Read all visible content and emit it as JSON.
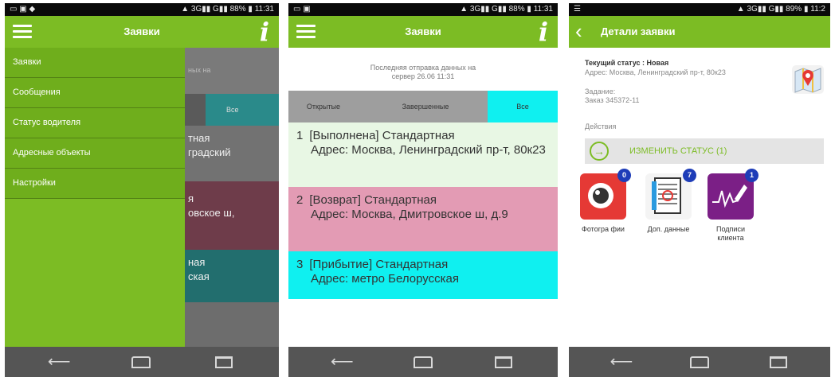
{
  "colors": {
    "accent": "#7cbc24",
    "active_tab": "#0ff0f0",
    "status_completed": "#e8f7e4",
    "status_return": "#e39bb4",
    "status_arrival": "#0ff0f0",
    "badge": "#1e3db8"
  },
  "status_bar": {
    "p1_time": "11:31",
    "p1_battery": "88%",
    "p2_time": "11:31",
    "p2_battery": "88%",
    "p3_time": "11:2",
    "p3_battery": "89%"
  },
  "panel1": {
    "title": "Заявки",
    "drawer_items": [
      "Заявки",
      "Сообщения",
      "Статус водителя",
      "Адресные объекты",
      "Настройки"
    ],
    "bg_text": {
      "top": "ных на",
      "tab": "Все",
      "l1": "тная",
      "l2": "градский",
      "l3": "я",
      "l4": "овское ш,",
      "l5": "ная",
      "l6": "ская"
    }
  },
  "panel2": {
    "title": "Заявки",
    "last_sync": {
      "line1": "Последняя отправка данных на",
      "line2": "сервер 26.06 11:31"
    },
    "tabs": [
      "Открытые",
      "Завершенные",
      "Все"
    ],
    "orders": [
      {
        "num": "1",
        "title": "[Выполнена] Стандартная",
        "address": "Адрес: Москва, Ленинградский пр-т, 80к23"
      },
      {
        "num": "2",
        "title": "[Возврат] Стандартная",
        "address": "Адрес: Москва, Дмитровское ш, д.9"
      },
      {
        "num": "3",
        "title": "[Прибытие] Стандартная",
        "address": "Адрес: метро Белорусская"
      }
    ]
  },
  "panel3": {
    "title": "Детали заявки",
    "status_line": "Текущий статус : Новая",
    "address": "Адрес: Москва, Ленинградский пр-т, 80к23",
    "task_label": "Задание:",
    "task_value": "Заказ 345372-11",
    "actions_label": "Действия",
    "change_status": "ИЗМЕНИТЬ СТАТУС (1)",
    "tiles": [
      {
        "label": "Фотогра фии",
        "badge": "0",
        "icon": "camera-icon"
      },
      {
        "label": "Доп. данные",
        "badge": "7",
        "icon": "document-icon"
      },
      {
        "label": "Подписи клиента",
        "badge": "1",
        "icon": "signature-icon"
      }
    ]
  }
}
